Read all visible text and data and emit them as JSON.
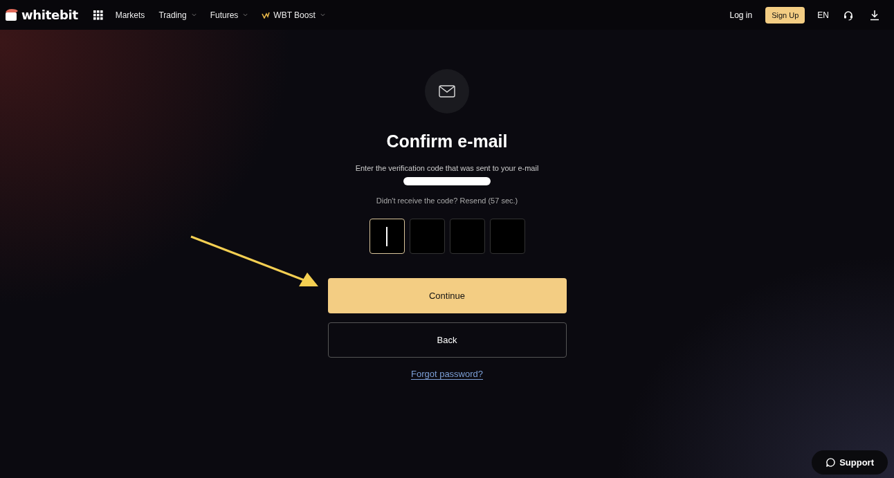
{
  "header": {
    "logo": "whitebit",
    "nav": [
      {
        "label": "Markets",
        "dropdown": false,
        "kind": "plain"
      },
      {
        "label": "Trading",
        "dropdown": true,
        "kind": "plain"
      },
      {
        "label": "Futures",
        "dropdown": true,
        "kind": "plain"
      },
      {
        "label": "WBT Boost",
        "dropdown": true,
        "kind": "boost"
      }
    ],
    "login": "Log in",
    "signup": "Sign Up",
    "language": "EN"
  },
  "form": {
    "title": "Confirm e-mail",
    "instruction": "Enter the verification code that was sent to your e-mail",
    "email_redacted": true,
    "resend": "Didn't receive the code? Resend (57 sec.)",
    "code_boxes": [
      {
        "focused": true
      },
      {
        "focused": false
      },
      {
        "focused": false
      },
      {
        "focused": false
      }
    ],
    "continue": "Continue",
    "back": "Back",
    "forgot": "Forgot password?"
  },
  "annotation_arrow": true,
  "support": "Support"
}
